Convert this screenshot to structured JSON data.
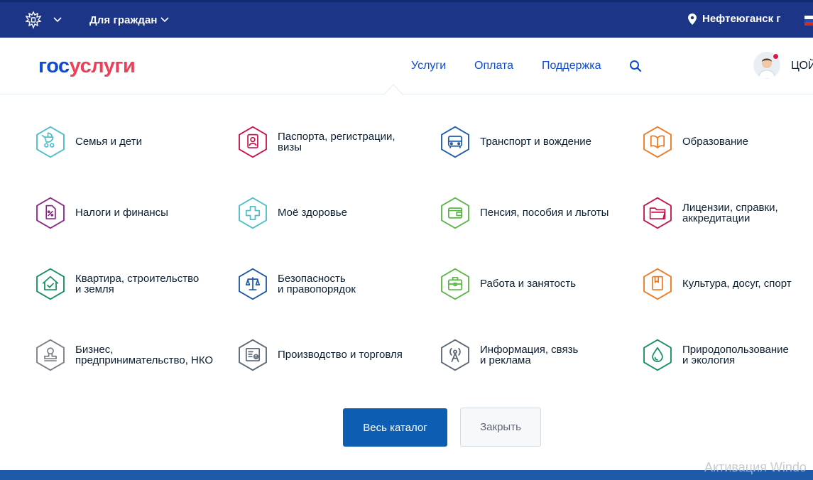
{
  "topbar": {
    "emblem_icon": "russian-coat-of-arms-icon",
    "audience_label": "Для граждан",
    "location_label": "Нефтеюганск г",
    "language_flag": "russia-flag-icon",
    "background": "#1c3587"
  },
  "header": {
    "logo": {
      "part1": "гос",
      "part2": "услуги"
    },
    "nav": [
      {
        "label": "Услуги"
      },
      {
        "label": "Оплата"
      },
      {
        "label": "Поддержка"
      }
    ],
    "search_icon": "search-icon",
    "user_name": "ЦОЙ"
  },
  "catalog": {
    "items": [
      {
        "label": "Семья и дети",
        "icon": "stroller-icon",
        "color": "#4dbec9"
      },
      {
        "label": "Паспорта, регистрации,\nвизы",
        "icon": "passport-icon",
        "color": "#c8144b"
      },
      {
        "label": "Транспорт и вождение",
        "icon": "car-icon",
        "color": "#1e5aa8"
      },
      {
        "label": "Образование",
        "icon": "book-icon",
        "color": "#ee7a20"
      },
      {
        "label": "Налоги и финансы",
        "icon": "tax-document-icon",
        "color": "#8a2a8a"
      },
      {
        "label": "Моё здоровье",
        "icon": "medical-cross-icon",
        "color": "#4dbec9"
      },
      {
        "label": "Пенсия, пособия и льготы",
        "icon": "wallet-icon",
        "color": "#5bb646"
      },
      {
        "label": "Лицензии, справки,\nаккредитации",
        "icon": "folder-icon",
        "color": "#c8144b"
      },
      {
        "label": "Квартира, строительство\nи земля",
        "icon": "house-check-icon",
        "color": "#15905e"
      },
      {
        "label": "Безопасность\nи правопорядок",
        "icon": "scales-icon",
        "color": "#1e5aa8"
      },
      {
        "label": "Работа и занятость",
        "icon": "briefcase-icon",
        "color": "#5bb646"
      },
      {
        "label": "Культура, досуг, спорт",
        "icon": "bookmark-book-icon",
        "color": "#ee7a20"
      },
      {
        "label": "Бизнес,\nпредпринимательство, НКО",
        "icon": "stamp-icon",
        "color": "#7a7f87"
      },
      {
        "label": "Производство и торговля",
        "icon": "certificate-icon",
        "color": "#5a6673"
      },
      {
        "label": "Информация, связь\nи реклама",
        "icon": "radio-tower-icon",
        "color": "#5a6673"
      },
      {
        "label": "Природопользование\nи экология",
        "icon": "water-drop-icon",
        "color": "#15905e"
      }
    ],
    "primary_button": "Весь каталог",
    "secondary_button": "Закрыть"
  },
  "watermark": "Активация Windo"
}
